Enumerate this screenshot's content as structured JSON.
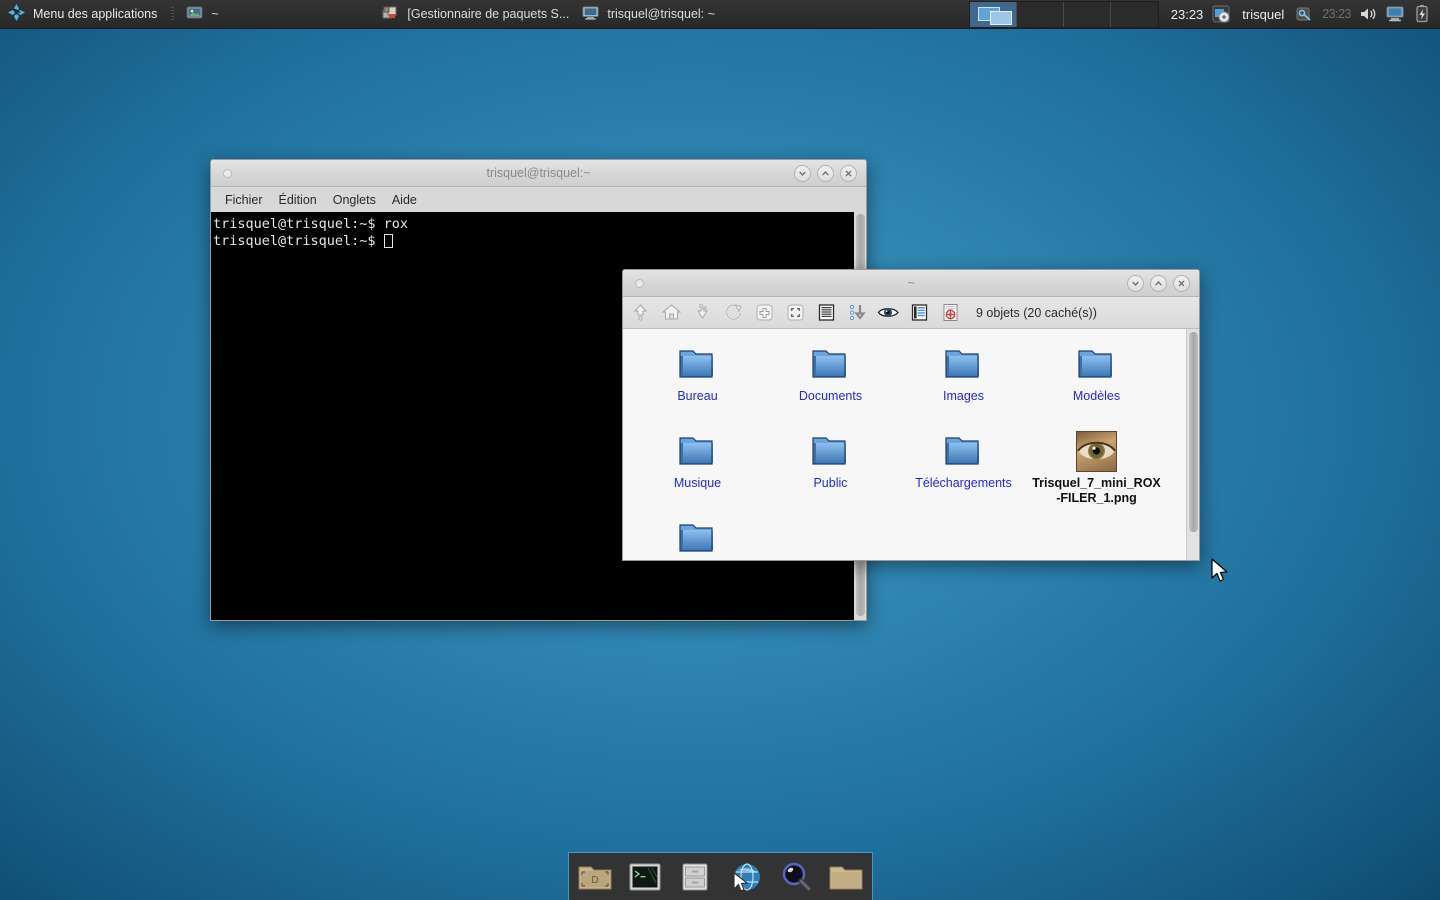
{
  "panel": {
    "applications_menu": "Menu des applications",
    "tasks": [
      {
        "label": "~",
        "icon": "image-viewer-icon"
      },
      {
        "label": "[Gestionnaire de paquets S...",
        "icon": "package-manager-icon"
      },
      {
        "label": "trisquel@trisquel: ~",
        "icon": "terminal-icon"
      }
    ],
    "workspaces": {
      "count": 4,
      "active_index": 0
    },
    "clock": "23:23",
    "user": "trisquel",
    "clock_secondary": "23:23",
    "tray_icons": [
      "update-manager-icon",
      "key-icon",
      "volume-icon",
      "display-icon",
      "battery-icon"
    ]
  },
  "terminal": {
    "title": "trisquel@trisquel:~",
    "menu": [
      "Fichier",
      "Édition",
      "Onglets",
      "Aide"
    ],
    "lines": [
      "trisquel@trisquel:~$ rox",
      "trisquel@trisquel:~$ "
    ],
    "window_buttons": [
      "minimize",
      "maximize",
      "close"
    ]
  },
  "filer": {
    "title": "~",
    "status": "9 objets (20 caché(s))",
    "toolbar": [
      {
        "name": "up-icon",
        "title": "Monter"
      },
      {
        "name": "home-icon",
        "title": "Dossier personnel"
      },
      {
        "name": "scan-icon",
        "title": "Rafraîchir le contenu"
      },
      {
        "name": "refresh-icon",
        "title": "Actualiser"
      },
      {
        "name": "new-window-icon",
        "title": "Nouvelle fenêtre"
      },
      {
        "name": "select-all-icon",
        "title": "Tout sélectionner"
      },
      {
        "name": "details-view-icon",
        "title": "Affichage détaillé"
      },
      {
        "name": "sort-icon",
        "title": "Trier"
      },
      {
        "name": "show-hidden-icon",
        "title": "Fichiers cachés"
      },
      {
        "name": "thumbnails-icon",
        "title": "Vignettes"
      },
      {
        "name": "help-icon",
        "title": "Aide"
      }
    ],
    "items": [
      {
        "label": "Bureau",
        "type": "folder"
      },
      {
        "label": "Documents",
        "type": "folder"
      },
      {
        "label": "Images",
        "type": "folder"
      },
      {
        "label": "Modèles",
        "type": "folder"
      },
      {
        "label": "Musique",
        "type": "folder"
      },
      {
        "label": "Public",
        "type": "folder"
      },
      {
        "label": "Téléchargements",
        "type": "folder"
      },
      {
        "label": "Trisquel_7_mini_ROX-FILER_1.png",
        "type": "image"
      },
      {
        "label": "",
        "type": "folder"
      }
    ]
  },
  "dock": {
    "items": [
      {
        "name": "dock-desktop-folder-icon",
        "label": "Bureau"
      },
      {
        "name": "dock-terminal-icon",
        "label": "Terminal"
      },
      {
        "name": "dock-file-manager-icon",
        "label": "Gestionnaire de fichiers"
      },
      {
        "name": "dock-web-browser-icon",
        "label": "Navigateur Web"
      },
      {
        "name": "dock-search-icon",
        "label": "Rechercher"
      },
      {
        "name": "dock-folder-icon",
        "label": "Dossier"
      }
    ]
  },
  "colors": {
    "desktop_primary": "#2f85b2",
    "dock_border": "#3f9ad0",
    "panel_bg": "#2e2e2e",
    "folder_label": "#1d2dd0"
  }
}
